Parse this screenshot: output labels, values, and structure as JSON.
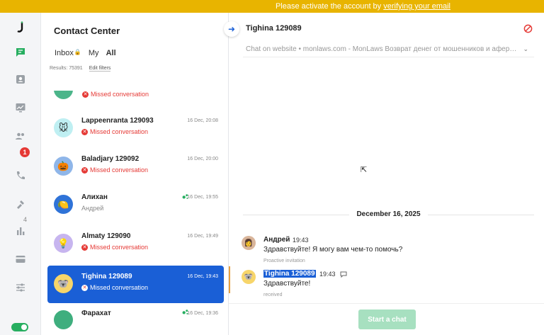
{
  "banner": {
    "prefix": "Please activate the account by ",
    "link": "verifying your email"
  },
  "sidebar": {
    "icons": [
      "logo-icon",
      "chats-icon",
      "contacts-icon",
      "reports-icon",
      "team-icon",
      "phone-icon",
      "automation-icon",
      "analytics-icon",
      "billing-icon",
      "settings-icon"
    ],
    "team_badge": "1",
    "automation_count": "4"
  },
  "list": {
    "title": "Contact Center",
    "tabs": [
      {
        "label": "Inbox"
      },
      {
        "label": "My"
      },
      {
        "label": "All"
      }
    ],
    "results_label": "Results: 75391",
    "edit_filters": "Edit filters",
    "top_partial_status": "Missed conversation",
    "conversations": [
      {
        "name": "Lappeenranta 129093",
        "status": "Missed conversation",
        "time": "16 Dec, 20:08",
        "avatar": "🐭",
        "avatar_bg": "#bfeff2"
      },
      {
        "name": "Baladjary 129092",
        "status": "Missed conversation",
        "time": "16 Dec, 20:00",
        "avatar": "🎃",
        "avatar_bg": "#8fb6e9"
      },
      {
        "name": "Алихан",
        "status": "Андрей",
        "time": "16 Dec, 19:55",
        "avatar": "🍋",
        "avatar_bg": "#2f73d8"
      },
      {
        "name": "Almaty 129090",
        "status": "Missed conversation",
        "time": "16 Dec, 19:49",
        "avatar": "💡",
        "avatar_bg": "#c7b5ef"
      },
      {
        "name": "Tighina 129089",
        "status": "Missed conversation",
        "time": "16 Dec, 19:43",
        "avatar": "🐨",
        "avatar_bg": "#f7d56a"
      },
      {
        "name": "Фарахат",
        "status": "",
        "time": "16 Dec, 19:36",
        "avatar": "",
        "avatar_bg": "#3fae7e"
      }
    ]
  },
  "chat": {
    "title": "Tighina 129089",
    "meta": "Chat on website • monlaws.com - MonLaws Возврат денег от мошенников и аферис...",
    "date_separator": "December 16, 2025",
    "messages": [
      {
        "name": "Андрей",
        "time": "19:43",
        "text": "Здравствуйте! Я могу вам чем-то помочь?",
        "note": "Proactive invitation"
      },
      {
        "name": "Tighina 129089",
        "time": "19:43",
        "text": "Здравствуйте!",
        "note": "received"
      }
    ],
    "start_button": "Start a chat"
  },
  "colors": {
    "accent": "#1a5fd6",
    "banner": "#e8b400",
    "missed": "#e53935",
    "online": "#27ae60"
  }
}
